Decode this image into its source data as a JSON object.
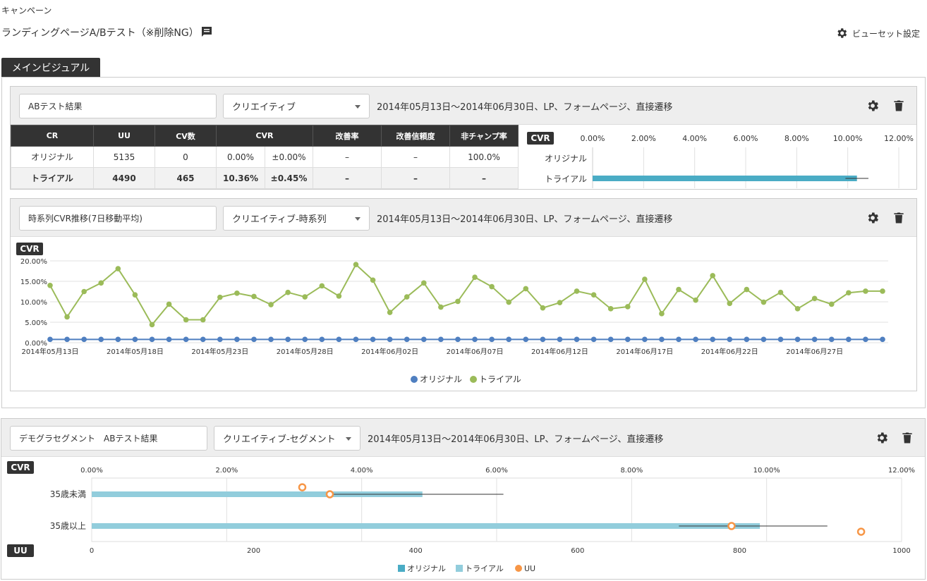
{
  "breadcrumb": "キャンペーン",
  "page_title": "ランディングページA/Bテスト（※削除NG）",
  "view_setting_label": "ビューセット設定",
  "tab_label": "メインビジュアル",
  "condition_text": "2014年05月13日〜2014年06月30日、LP、フォームページ、直接遷移",
  "panel1": {
    "name_value": "ABテスト結果",
    "select_value": "クリエイティブ",
    "table": {
      "headers": [
        "CR",
        "UU",
        "CV数",
        "CVR",
        "改善率",
        "改善信頼度",
        "非チャンプ率"
      ],
      "rows": [
        {
          "cr": "オリジナル",
          "uu": "5135",
          "cv": "0",
          "cvr": "0.00%",
          "pm": "±0.00%",
          "imp": "–",
          "conf": "–",
          "nonchamp": "100.0%"
        },
        {
          "cr": "トライアル",
          "uu": "4490",
          "cv": "465",
          "cvr": "10.36%",
          "pm": "±0.45%",
          "imp": "–",
          "conf": "–",
          "nonchamp": "–"
        }
      ]
    },
    "chart_tag": "CVR"
  },
  "panel2": {
    "name_value": "時系列CVR推移(7日移動平均)",
    "select_value": "クリエイティブ-時系列",
    "chart_tag": "CVR"
  },
  "panel3": {
    "name_value": "デモグラセグメント　ABテスト結果",
    "select_value": "クリエイティブ-セグメント",
    "cvr_tag": "CVR",
    "uu_tag": "UU"
  },
  "colors": {
    "original": "#4f7fc0",
    "trial": "#9bbb59",
    "bar_trial": "#4aacc5",
    "bar_segment": "#92cddc",
    "uu": "#f79646",
    "dark": "#333333"
  },
  "chart_data": [
    {
      "type": "bar",
      "orientation": "horizontal",
      "categories": [
        "オリジナル",
        "トライアル"
      ],
      "values": [
        0.0,
        10.36
      ],
      "error": [
        0.0,
        0.45
      ],
      "xlim": [
        0,
        12
      ],
      "xticks": [
        "0.00%",
        "2.00%",
        "4.00%",
        "6.00%",
        "8.00%",
        "10.00%",
        "12.00%"
      ]
    },
    {
      "type": "line",
      "yticks": [
        "0.00%",
        "5.00%",
        "10.00%",
        "15.00%",
        "20.00%"
      ],
      "ylim": [
        0,
        20
      ],
      "xticks": [
        "2014年05月13日",
        "2014年05月18日",
        "2014年05月23日",
        "2014年05月28日",
        "2014年06月02日",
        "2014年06月07日",
        "2014年06月12日",
        "2014年06月17日",
        "2014年06月22日",
        "2014年06月27日"
      ],
      "legend": [
        "オリジナル",
        "トライアル"
      ],
      "series": [
        {
          "name": "オリジナル",
          "values": [
            0.8,
            0.8,
            0.8,
            0.8,
            0.8,
            0.8,
            0.8,
            0.8,
            0.8,
            0.8,
            0.8,
            0.8,
            0.8,
            0.8,
            0.8,
            0.8,
            0.8,
            0.8,
            0.8,
            0.8,
            0.8,
            0.8,
            0.8,
            0.8,
            0.8,
            0.8,
            0.8,
            0.8,
            0.8,
            0.8,
            0.8,
            0.8,
            0.8,
            0.8,
            0.8,
            0.8,
            0.8,
            0.8,
            0.8,
            0.8,
            0.8,
            0.8,
            0.8,
            0.8,
            0.8,
            0.8,
            0.8,
            0.8,
            0.8,
            0.8
          ]
        },
        {
          "name": "トライアル",
          "values": [
            14.0,
            6.3,
            12.5,
            14.6,
            18.1,
            11.7,
            4.4,
            9.4,
            5.6,
            5.6,
            11.1,
            12.1,
            11.3,
            9.3,
            12.3,
            11.2,
            13.9,
            11.4,
            19.1,
            15.3,
            7.4,
            11.2,
            14.6,
            8.7,
            10.1,
            16.0,
            13.7,
            9.9,
            13.2,
            8.5,
            9.8,
            12.6,
            11.7,
            8.3,
            8.8,
            15.5,
            7.1,
            13.0,
            10.4,
            16.4,
            9.6,
            13.0,
            9.9,
            12.3,
            8.3,
            10.8,
            9.4,
            12.2,
            12.6,
            12.6
          ]
        }
      ]
    },
    {
      "type": "bar",
      "orientation": "horizontal",
      "categories": [
        "35歳未満",
        "35歳以上"
      ],
      "series": [
        {
          "name": "トライアル",
          "values": [
            4.9,
            9.9
          ],
          "error": [
            [
              3.5,
              6.1
            ],
            [
              8.7,
              10.9
            ]
          ]
        }
      ],
      "xlim": [
        0,
        12
      ],
      "xticks": [
        "0.00%",
        "2.00%",
        "4.00%",
        "6.00%",
        "8.00%",
        "10.00%",
        "12.00%"
      ],
      "uu_axis": {
        "xlim": [
          0,
          1000
        ],
        "xticks": [
          "0",
          "200",
          "400",
          "600",
          "800",
          "1000"
        ]
      },
      "uu_points": [
        {
          "name": "オリジナル",
          "values": [
            260,
            950
          ]
        },
        {
          "name": "トライアル",
          "values": [
            294,
            790
          ]
        }
      ],
      "legend": [
        "オリジナル",
        "トライアル",
        "UU"
      ]
    }
  ]
}
